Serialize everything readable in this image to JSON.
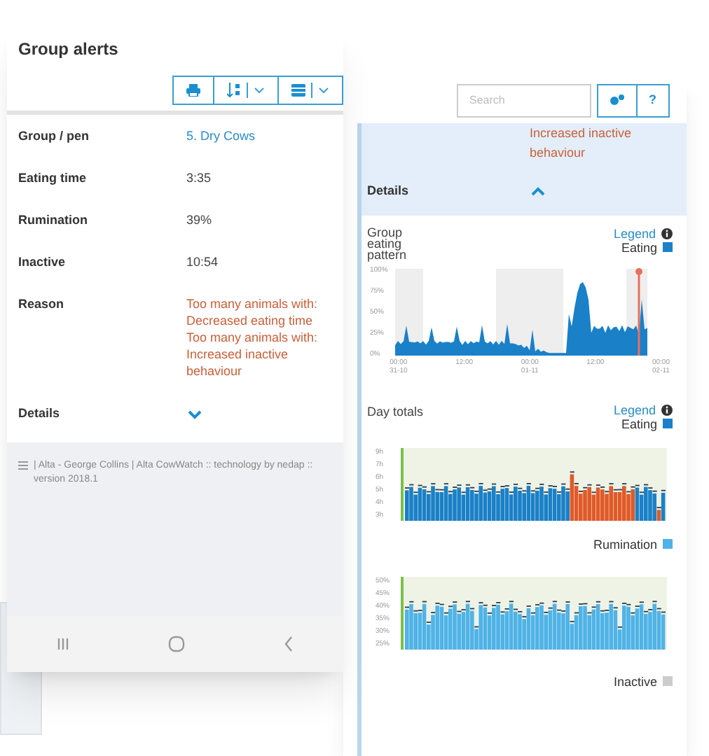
{
  "left_screen": {
    "title": "Group alerts",
    "toolbar": [
      {
        "kind": "print"
      },
      {
        "kind": "sort"
      },
      {
        "kind": "table"
      }
    ],
    "fields": [
      {
        "label": "Group / pen",
        "kind": "link",
        "value": "5. Dry Cows"
      },
      {
        "label": "Eating time",
        "kind": "plain",
        "value": "3:35"
      },
      {
        "label": "Rumination",
        "kind": "plain",
        "value": "39%"
      },
      {
        "label": "Inactive",
        "kind": "plain",
        "value": "10:54"
      },
      {
        "label": "Reason",
        "kind": "alert",
        "lines": [
          "Too many animals with:",
          "Decreased eating time",
          "Too many animals with:",
          "Increased inactive behaviour"
        ]
      }
    ],
    "details": {
      "label": "Details",
      "expanded": false
    },
    "footer": "|  Alta - George Collins  |  Alta CowWatch :: technology by nedap :: version 2018.1"
  },
  "right_screen": {
    "search": {
      "placeholder": "Search"
    },
    "help_button": "?",
    "reason_tail": "Increased inactive behaviour",
    "details": {
      "label": "Details",
      "expanded": true
    },
    "charts": [
      {
        "kind": "area",
        "title": "Group eating pattern",
        "legend": "Legend",
        "series_label": "Eating",
        "color": "#1a80c8",
        "y_ticks": [
          "100%",
          "75%",
          "50%",
          "25%",
          "0%"
        ],
        "x_ticks": [
          [
            "00:00",
            "31-10"
          ],
          [
            "12:00"
          ],
          [
            "00:00",
            "01-11"
          ],
          [
            "12:00"
          ],
          [
            "00:00",
            "02-11"
          ]
        ]
      },
      {
        "kind": "bars",
        "title": "Day totals",
        "legend": "Legend",
        "series_label": "Eating",
        "color": "#1a80c8",
        "y_ticks": [
          "9h",
          "7h",
          "6h",
          "5h",
          "4h",
          "3h"
        ]
      },
      {
        "kind": "bars",
        "series_label": "Rumination",
        "color": "#4fb3e8",
        "y_ticks": [
          "50%",
          "45%",
          "40%",
          "35%",
          "30%",
          "25%"
        ]
      },
      {
        "kind": "empty",
        "series_label": "Inactive",
        "color": "#cccccc"
      }
    ]
  }
}
